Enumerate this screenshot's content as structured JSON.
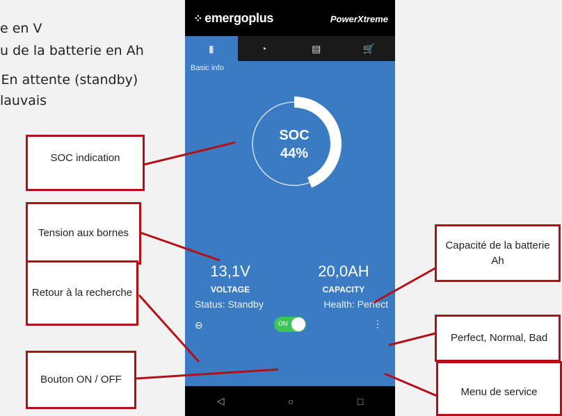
{
  "background_text": [
    "e en V",
    "u de la batterie en Ah",
    "– En attente (standby)",
    "lauvais"
  ],
  "app": {
    "brand": "emergoplus",
    "product": "PowerXtreme",
    "tabs": [
      {
        "icon": "battery-icon",
        "glyph": "▮"
      },
      {
        "icon": "gauge-icon",
        "glyph": "◔"
      },
      {
        "icon": "document-icon",
        "glyph": "▤"
      },
      {
        "icon": "cart-icon",
        "glyph": "🛒"
      }
    ],
    "section_title": "Basic info",
    "soc": {
      "label": "SOC",
      "value": "44%",
      "fraction": 0.44
    },
    "voltage": {
      "value": "13,1V",
      "label": "VOLTAGE"
    },
    "capacity": {
      "value": "20,0AH",
      "label": "CAPACITY"
    },
    "status": "Status: Standby",
    "health": "Health: Perfect",
    "toggle_label": "ON",
    "nav": {
      "back": "◁",
      "home": "○",
      "recent": "□"
    }
  },
  "callouts": {
    "soc": "SOC indication",
    "voltage": "Tension aux bornes",
    "back": "Retour à la recherche",
    "onoff": "Bouton ON / OFF",
    "capacity": "Capacité de la batterie Ah",
    "health": "Perfect, Normal, Bad",
    "menu": "Menu de service"
  },
  "colors": {
    "screen": "#3a7bc4",
    "callout_border": "#b50f16",
    "toggle": "#3ec35a"
  }
}
